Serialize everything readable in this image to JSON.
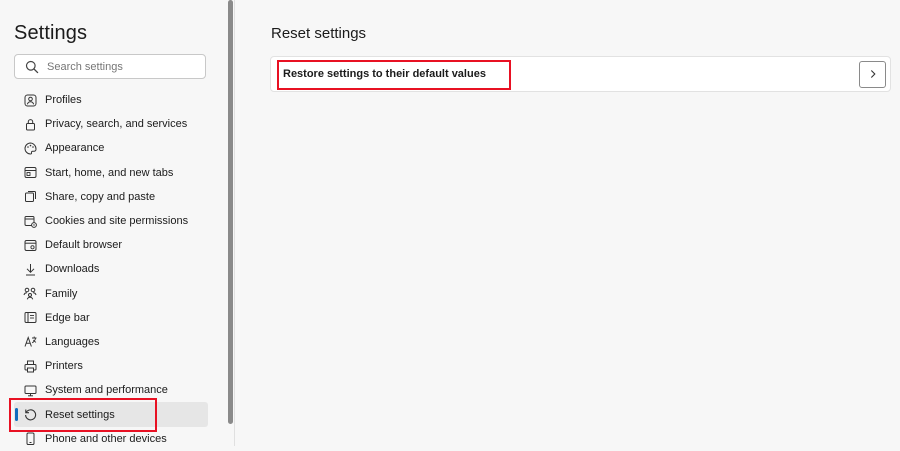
{
  "sidebar": {
    "title": "Settings",
    "search": {
      "placeholder": "Search settings",
      "value": ""
    },
    "items": [
      {
        "label": "Profiles",
        "icon": "profile-icon"
      },
      {
        "label": "Privacy, search, and services",
        "icon": "lock-icon"
      },
      {
        "label": "Appearance",
        "icon": "palette-icon"
      },
      {
        "label": "Start, home, and new tabs",
        "icon": "home-tabs-icon"
      },
      {
        "label": "Share, copy and paste",
        "icon": "share-icon"
      },
      {
        "label": "Cookies and site permissions",
        "icon": "cookie-permissions-icon"
      },
      {
        "label": "Default browser",
        "icon": "browser-icon"
      },
      {
        "label": "Downloads",
        "icon": "download-icon"
      },
      {
        "label": "Family",
        "icon": "family-icon"
      },
      {
        "label": "Edge bar",
        "icon": "edge-bar-icon"
      },
      {
        "label": "Languages",
        "icon": "language-icon"
      },
      {
        "label": "Printers",
        "icon": "printer-icon"
      },
      {
        "label": "System and performance",
        "icon": "system-icon"
      },
      {
        "label": "Reset settings",
        "icon": "reset-icon",
        "active": true
      },
      {
        "label": "Phone and other devices",
        "icon": "phone-icon"
      }
    ]
  },
  "main": {
    "title": "Reset settings",
    "options": [
      {
        "label": "Restore settings to their default values",
        "icon": "chevron-right-icon"
      }
    ]
  },
  "colors": {
    "accent": "#0f6cbd",
    "highlight": "#e81123",
    "background": "#f7f7f7"
  }
}
